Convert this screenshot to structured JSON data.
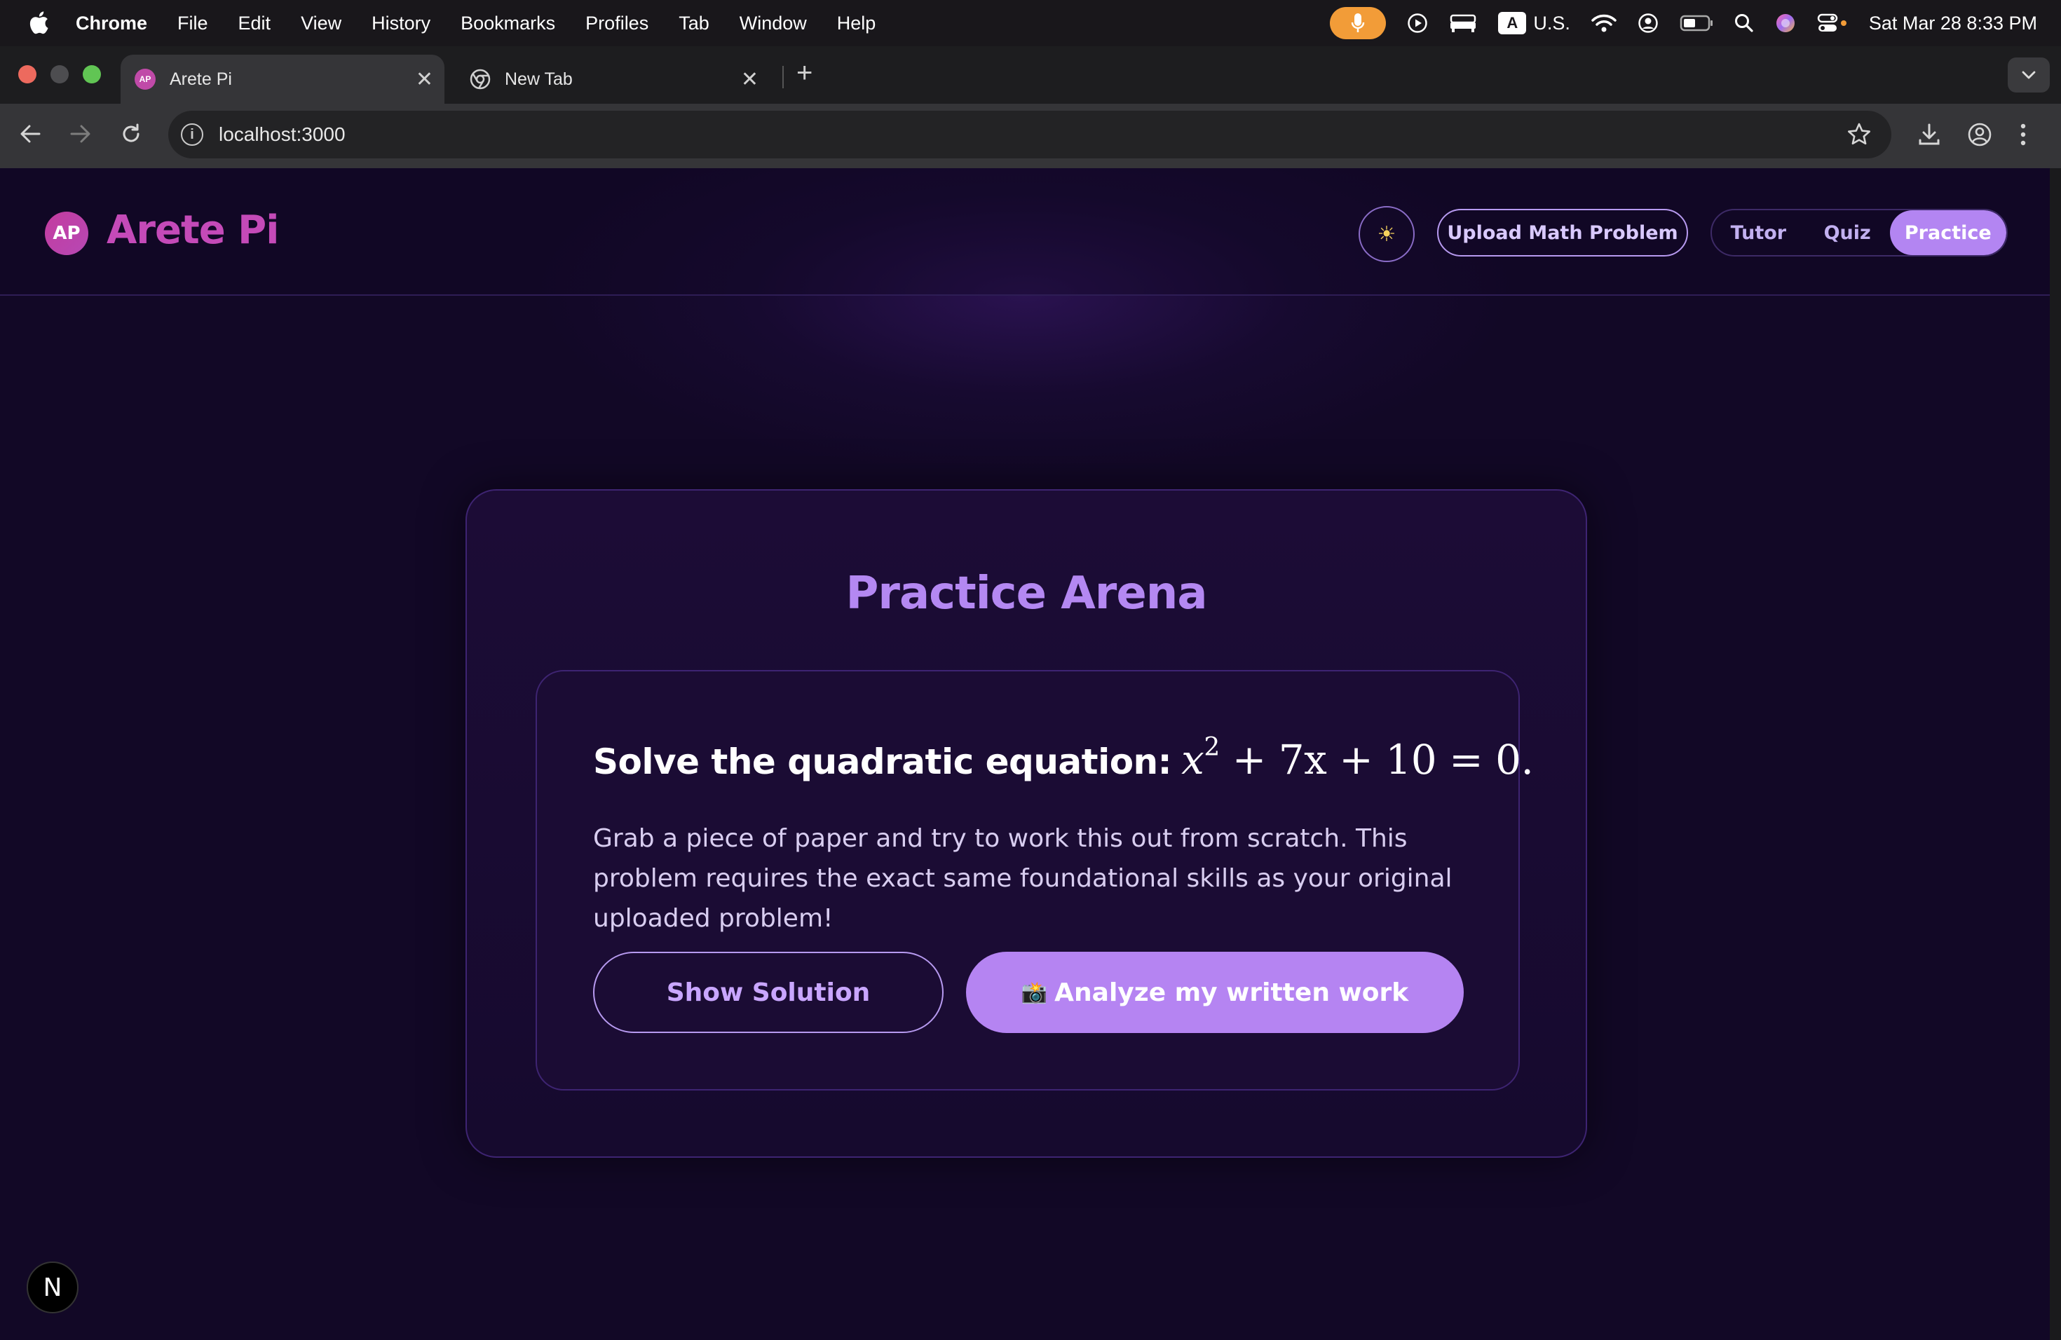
{
  "menubar": {
    "app_name": "Chrome",
    "items": [
      "File",
      "Edit",
      "View",
      "History",
      "Bookmarks",
      "Profiles",
      "Tab",
      "Window",
      "Help"
    ],
    "keyboard_badge": "A",
    "keyboard_layout": "U.S.",
    "clock": "Sat Mar 28  8:33 PM"
  },
  "browser": {
    "tabs": [
      {
        "title": "Arete Pi",
        "favicon_text": "AP",
        "active": true
      },
      {
        "title": "New Tab",
        "active": false
      }
    ],
    "url": "localhost:3000"
  },
  "header": {
    "logo_text": "AP",
    "brand": "Arete Pi",
    "theme_toggle_icon": "sun-icon",
    "upload_label": "Upload Math Problem",
    "modes": [
      "Tutor",
      "Quiz",
      "Practice"
    ],
    "active_mode": "Practice"
  },
  "practice": {
    "title": "Practice Arena",
    "question_prefix": "Solve the quadratic equation:",
    "equation": {
      "base": "x",
      "exponent": "2",
      "rest": "+ 7x + 10 = 0."
    },
    "description": "Grab a piece of paper and try to work this out from scratch. This problem requires the exact same foundational skills as your original uploaded problem!",
    "show_solution_label": "Show Solution",
    "analyze_icon": "📸",
    "analyze_label": "Analyze my written work"
  },
  "dev_badge": "N",
  "colors": {
    "accent": "#b385f2",
    "brand": "#c44ab8",
    "background": "#120826"
  }
}
